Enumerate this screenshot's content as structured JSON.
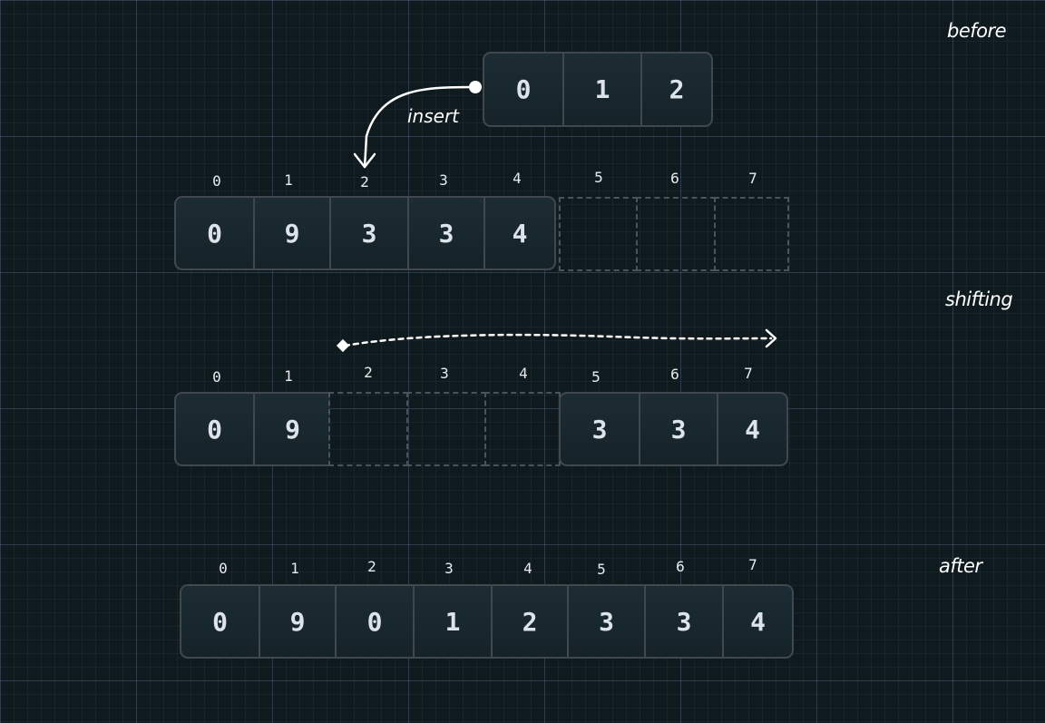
{
  "labels": {
    "before": "before",
    "shifting": "shifting",
    "after": "after",
    "insert": "insert"
  },
  "insert_array": [
    "0",
    "1",
    "2"
  ],
  "before": {
    "indices": [
      "0",
      "1",
      "2",
      "3",
      "4",
      "5",
      "6",
      "7"
    ],
    "values": [
      "0",
      "9",
      "3",
      "3",
      "4"
    ]
  },
  "shifting": {
    "indices": [
      "0",
      "1",
      "2",
      "3",
      "4",
      "5",
      "6",
      "7"
    ],
    "left_values": [
      "0",
      "9"
    ],
    "right_values": [
      "3",
      "3",
      "4"
    ]
  },
  "after": {
    "indices": [
      "0",
      "1",
      "2",
      "3",
      "4",
      "5",
      "6",
      "7"
    ],
    "values": [
      "0",
      "9",
      "0",
      "1",
      "2",
      "3",
      "3",
      "4"
    ]
  },
  "colors": {
    "background": "#0f1a1e",
    "cell_border": "#40474f",
    "cell_text": "#dde3ea",
    "annotation": "#ffffff"
  }
}
